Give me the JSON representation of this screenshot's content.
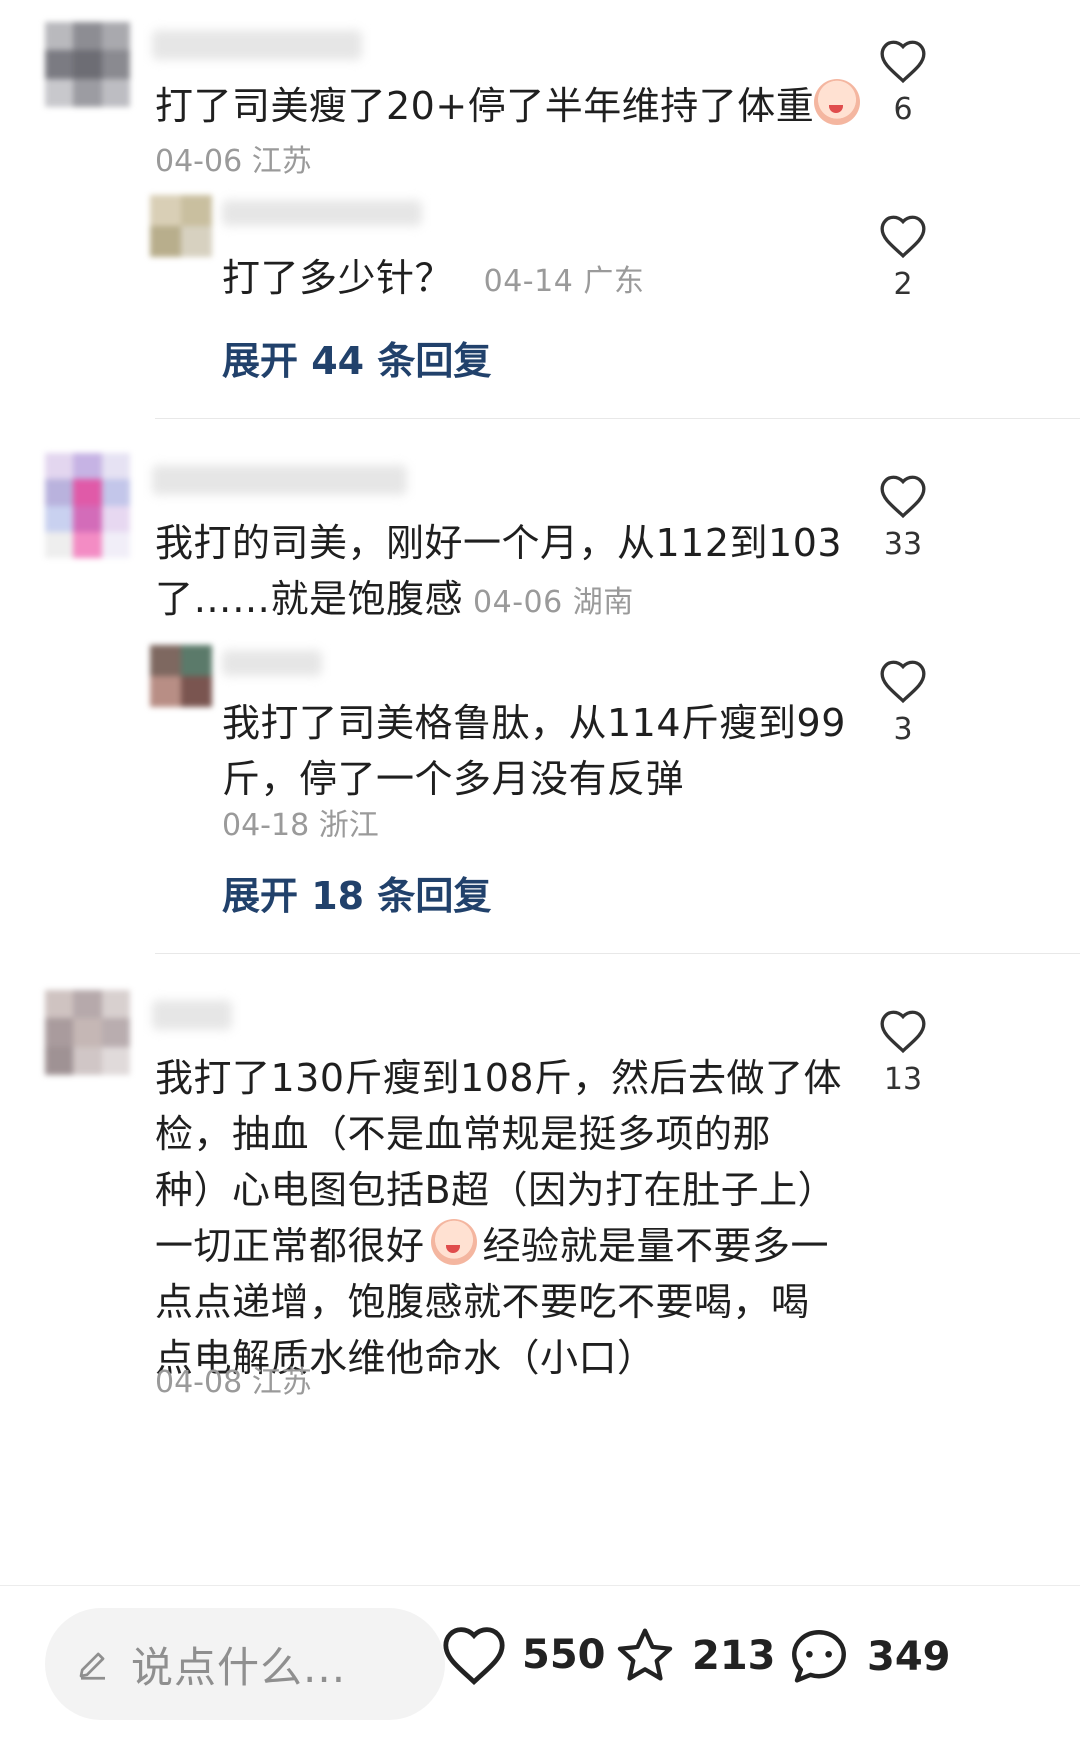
{
  "comments": [
    {
      "text": "打了司美瘦了20+停了半年维持了体重",
      "meta": "04-06 江苏",
      "likes": "6",
      "reply": {
        "text": "打了多少针？",
        "meta": "04-14 广东",
        "likes": "2"
      },
      "expand": "展开 44 条回复"
    },
    {
      "text_line1": "我打的司美，刚好一个月，从112到103",
      "text_line2": "了……就是饱腹感",
      "meta": "04-06 湖南",
      "likes": "33",
      "reply": {
        "text_line1": "我打了司美格鲁肽，从114斤瘦到99",
        "text_line2": "斤，停了一个多月没有反弹",
        "meta": "04-18 浙江",
        "likes": "3"
      },
      "expand": "展开 18 条回复"
    },
    {
      "lines": [
        "我打了130斤瘦到108斤，然后去做了体",
        "检，抽血（不是血常规是挺多项的那",
        "种）心电图包括B超（因为打在肚子上）",
        "一切正常都很好",
        "经验就是量不要多一",
        "点点递增，饱腹感就不要吃不要喝，喝",
        "点电解质水维他命水（小口）"
      ],
      "meta": "04-08 江苏",
      "likes": "13"
    }
  ],
  "bottom_bar": {
    "input_placeholder": "说点什么...",
    "like_count": "550",
    "star_count": "213",
    "comment_count": "349"
  }
}
